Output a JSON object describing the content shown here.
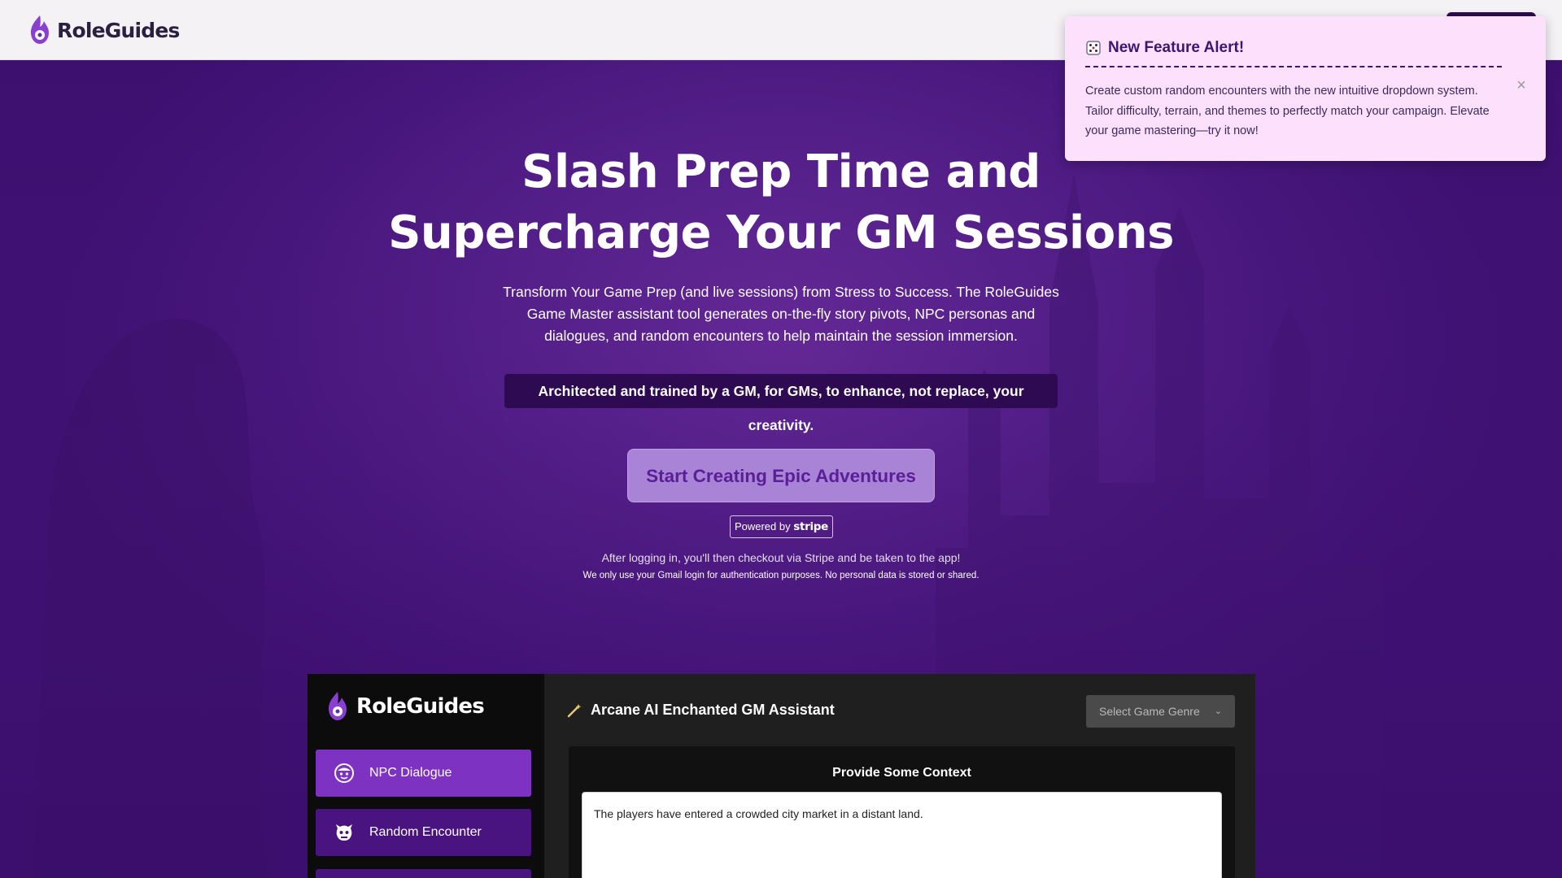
{
  "header": {
    "brand": "RoleGuides",
    "logo_icon": "flame-pin-logo"
  },
  "hero": {
    "headline_line1": "Slash Prep Time and",
    "headline_line2": "Supercharge Your GM Sessions",
    "subcopy": "Transform Your Game Prep (and live sessions) from Stress to Success. The RoleGuides Game Master assistant tool generates on-the-fly story pivots, NPC personas and dialogues, and random encounters to help maintain the session immersion.",
    "tagline": "Architected and trained by a GM, for GMs, to enhance, not replace, your creativity.",
    "cta_label": "Start Creating Epic Adventures",
    "stripe_prefix": "Powered by",
    "stripe_brand": "stripe",
    "note_checkout": "After logging in, you'll then checkout via Stripe and be taken to the app!",
    "note_privacy": "We only use your Gmail login for authentication purposes. No personal data is stored or shared."
  },
  "preview": {
    "brand": "RoleGuides",
    "nav": [
      {
        "label": "NPC Dialogue",
        "icon": "npc-face-icon"
      },
      {
        "label": "Random Encounter",
        "icon": "monster-icon"
      }
    ],
    "title": "Arcane AI Enchanted GM Assistant",
    "title_icon": "magic-wand-icon",
    "genre_placeholder": "Select Game Genre",
    "context_title": "Provide Some Context",
    "context_value": "The players have entered a crowded city market in a distant land."
  },
  "alert": {
    "icon": "dice-icon",
    "title": "New Feature Alert!",
    "body": "Create custom random encounters with the new intuitive dropdown system. Tailor difficulty, terrain, and themes to perfectly match your campaign. Elevate your game mastering—try it now!"
  },
  "colors": {
    "accent_purple": "#7e32c2",
    "dark_purple": "#2b0b4e",
    "alert_bg": "#fde0fb",
    "cta_bg": "#a883d6"
  }
}
